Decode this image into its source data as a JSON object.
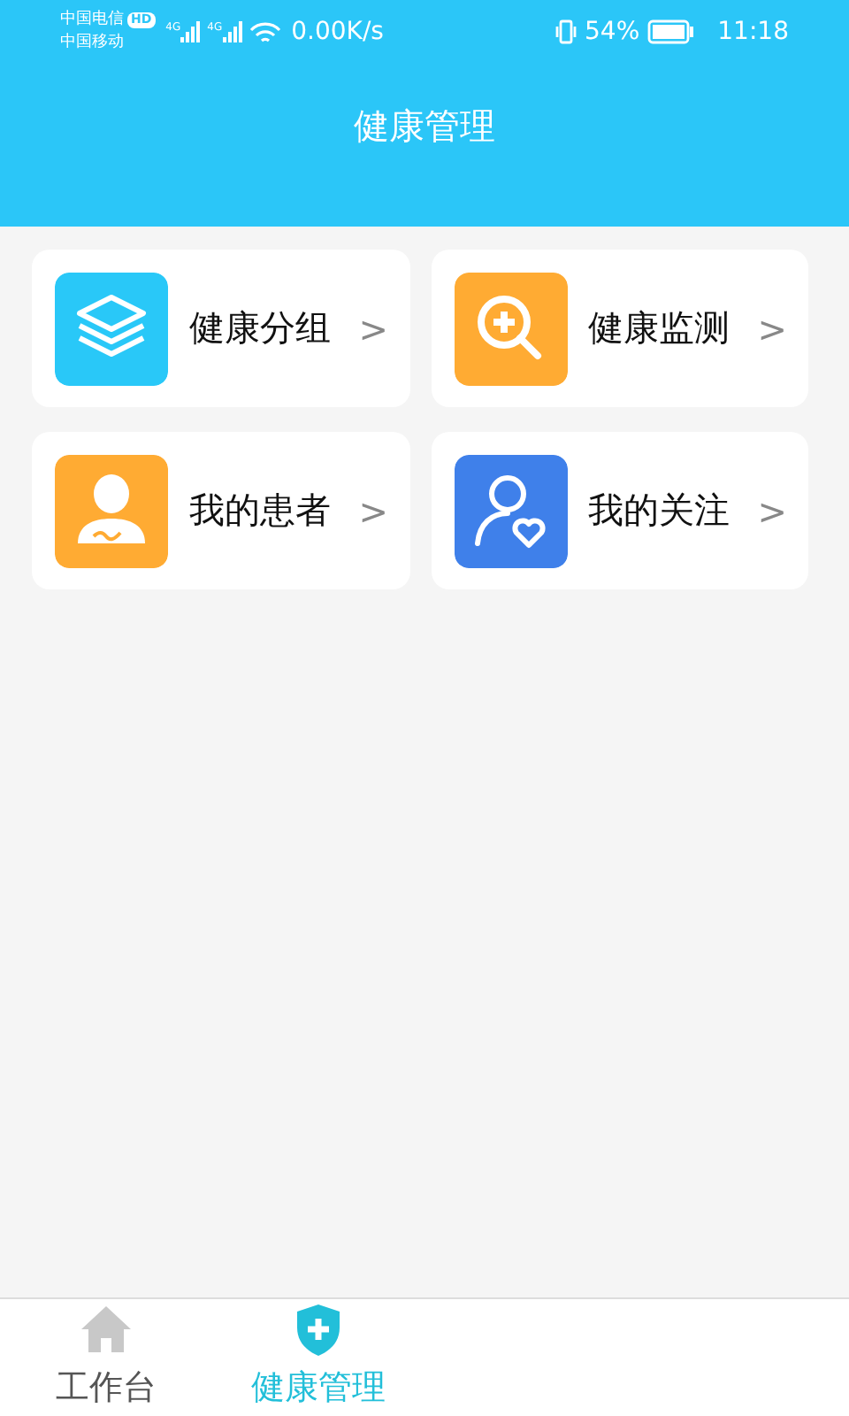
{
  "status_bar": {
    "carrier_1": "中国电信",
    "hd_badge": "HD",
    "carrier_2": "中国移动",
    "network_1": "4G",
    "network_2": "4G",
    "speed": "0.00K/s",
    "battery": "54%",
    "time": "11:18"
  },
  "header": {
    "title": "健康管理"
  },
  "menu": [
    {
      "label": "健康分组",
      "kind": "layers",
      "color": "#29c8f8",
      "chevron": ">"
    },
    {
      "label": "健康监测",
      "kind": "search-plus",
      "color": "#ffab33",
      "chevron": ">"
    },
    {
      "label": "我的患者",
      "kind": "person",
      "color": "#ffab33",
      "chevron": ">"
    },
    {
      "label": "我的关注",
      "kind": "person-heart",
      "color": "#3f80ea",
      "chevron": ">"
    }
  ],
  "tab_bar": [
    {
      "label": "工作台",
      "kind": "home",
      "selected": false
    },
    {
      "label": "健康管理",
      "kind": "shield",
      "selected": true
    }
  ]
}
